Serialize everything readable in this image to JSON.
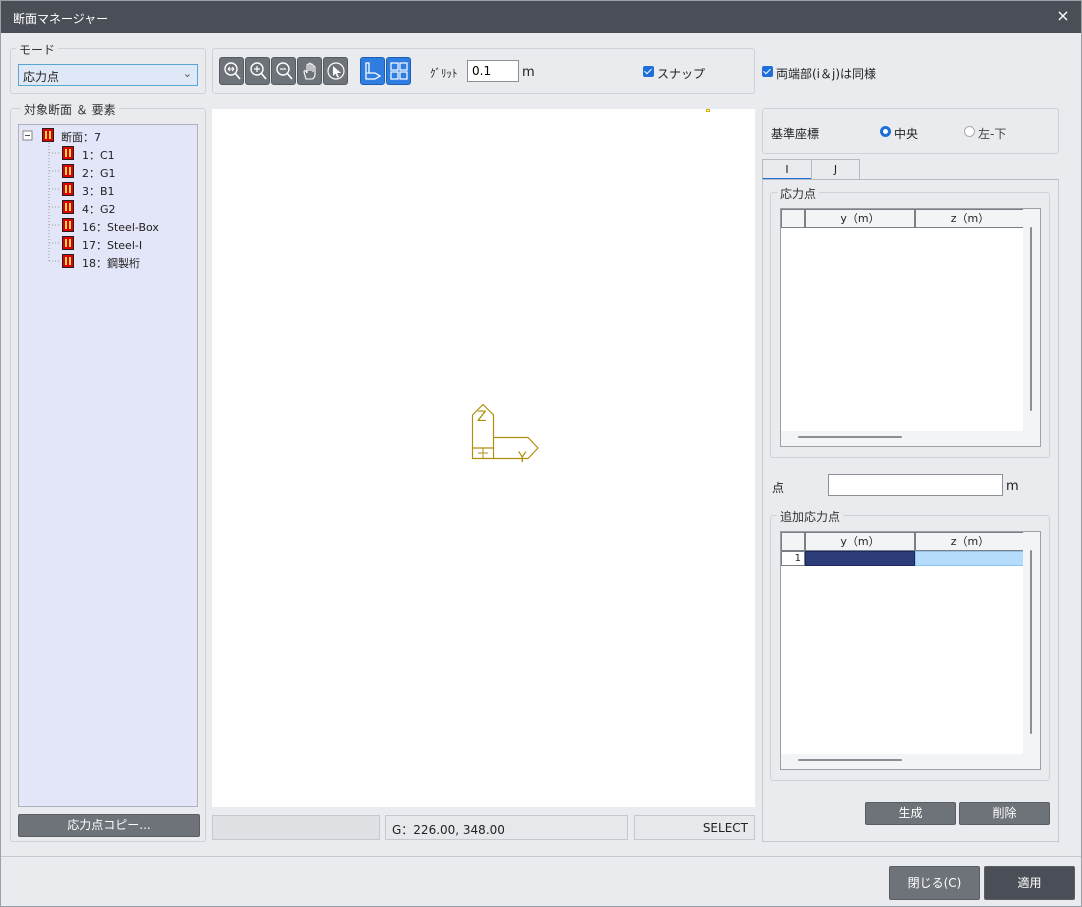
{
  "window": {
    "title": "断面マネージャー",
    "close_icon": "×"
  },
  "mode": {
    "label": "モード",
    "value": "応力点"
  },
  "toolbar": {
    "grid_label": "ｸﾞﾘｯﾄ",
    "grid_value": "0.1",
    "grid_unit": "m",
    "snap_label": "スナップ",
    "icons": [
      "zoom-fit-icon",
      "zoom-in-icon",
      "zoom-out-icon",
      "pan-hand-icon",
      "select-arrow-icon",
      "section-view-icon",
      "grid-view-icon"
    ]
  },
  "same_ends_label": "両端部(i＆j)は同様",
  "targets": {
    "label": "対象断面 ＆ 要素",
    "root": "断面：7",
    "items": [
      "1：C1",
      "2：G1",
      "3：B1",
      "4：G2",
      "16：Steel-Box",
      "17：Steel-I",
      "18：鋼製桁"
    ]
  },
  "copy_button": "応力点コピー...",
  "axes": {
    "z_label": "Z",
    "y_label": "Y"
  },
  "status": {
    "left": "",
    "coords": "G：226.00, 348.00",
    "mode": "SELECT"
  },
  "reference": {
    "label": "基準座標",
    "option_center": "中央",
    "option_bottom_left": "左-下"
  },
  "tabs": [
    "I",
    "J"
  ],
  "stress_points": {
    "label": "応力点",
    "columns": [
      "",
      "y（m）",
      "z（m）"
    ]
  },
  "point_field": {
    "label": "点",
    "unit": "m",
    "value": ""
  },
  "additional_points": {
    "label": "追加応力点",
    "columns": [
      "",
      "y（m）",
      "z（m）"
    ],
    "rows": [
      {
        "no": "1",
        "y": "",
        "z": ""
      }
    ]
  },
  "buttons": {
    "generate": "生成",
    "delete": "削除",
    "close": "閉じる(C)",
    "apply": "適用"
  },
  "colors": {
    "accent": "#1e6fd9",
    "axis": "#b08f10",
    "tree_bg": "#e3e5f8",
    "selected_cell": "#2c3d7a",
    "selected_cell_light": "#b6dcfb"
  }
}
